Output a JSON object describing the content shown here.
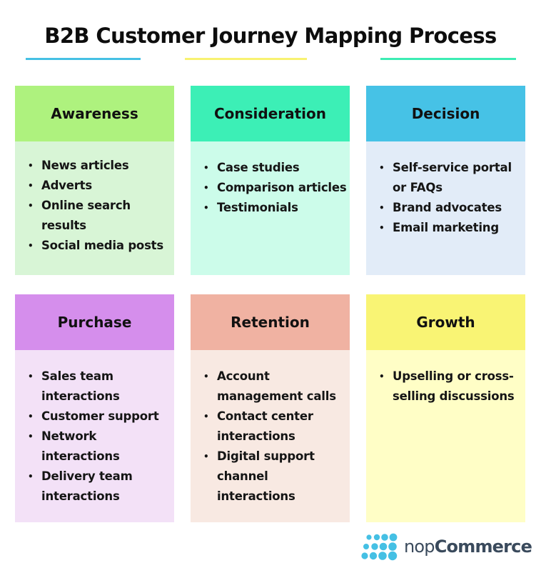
{
  "title": "B2B Customer Journey Mapping Process",
  "title_underline_colors": [
    "#45c0e4",
    "#f8f271",
    "#3cecb4"
  ],
  "stages": [
    {
      "name": "Awareness",
      "header_color": "#aef27e",
      "body_color": "#d8f5d6",
      "items": [
        "News articles",
        "Adverts",
        "Online search results",
        "Social media posts"
      ]
    },
    {
      "name": "Consideration",
      "header_color": "#3cefb6",
      "body_color": "#ccfcea",
      "items": [
        "Case studies",
        "Comparison articles",
        "Testimonials"
      ]
    },
    {
      "name": "Decision",
      "header_color": "#46c2e6",
      "body_color": "#e2ecf8",
      "items": [
        "Self-service portal or FAQs",
        "Brand advocates",
        "Email marketing"
      ]
    },
    {
      "name": "Purchase",
      "header_color": "#d58eec",
      "body_color": "#f3e1f7",
      "items": [
        "Sales team interactions",
        "Customer support",
        "Network interactions",
        "Delivery team interactions"
      ]
    },
    {
      "name": "Retention",
      "header_color": "#f0b2a2",
      "body_color": "#f8e9e2",
      "items": [
        "Account management calls",
        "Contact center interactions",
        "Digital support channel interactions"
      ]
    },
    {
      "name": "Growth",
      "header_color": "#f9f474",
      "body_color": "#fffec6",
      "items": [
        "Upselling or cross-selling discussions"
      ]
    }
  ],
  "logo": {
    "icon": "dots-grid-icon",
    "text_light": "nop",
    "text_bold": "Commerce",
    "color": "#45c0e4"
  }
}
